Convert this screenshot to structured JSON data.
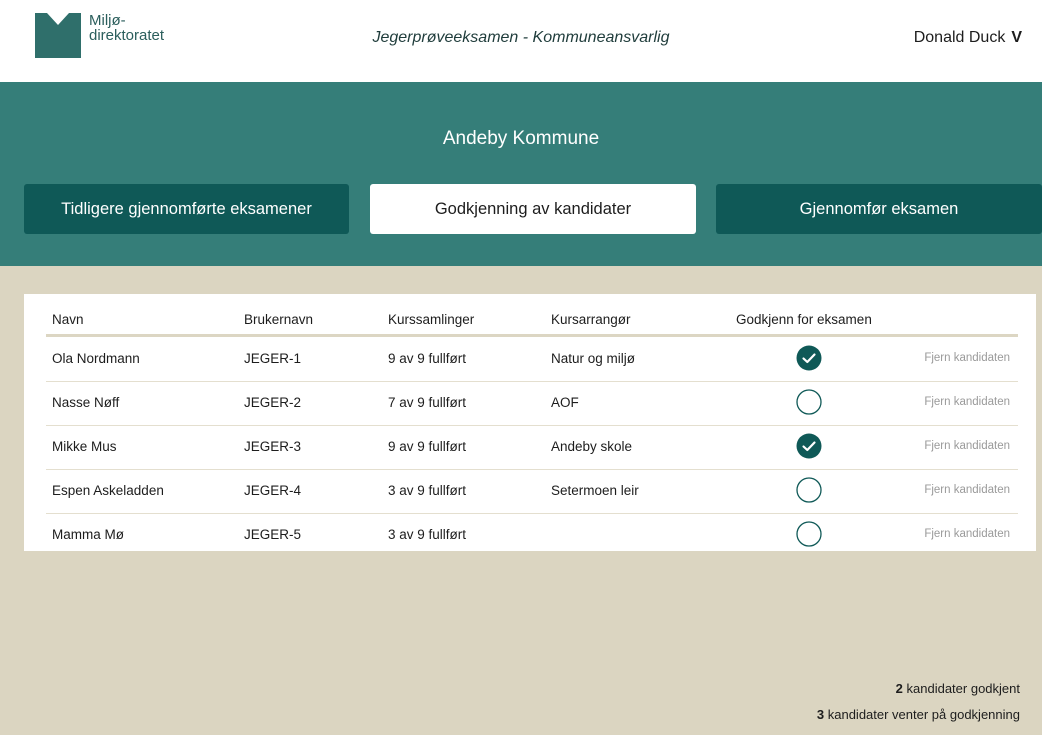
{
  "header": {
    "logo_line1": "Miljø-",
    "logo_line2": "direktoratet",
    "title": "Jegerprøveeksamen - Kommuneansvarlig",
    "user_name": "Donald Duck",
    "user_chevron": "V"
  },
  "municipality": "Andeby Kommune",
  "tabs": [
    {
      "label": "Tidligere gjennomførte eksamener",
      "active": false
    },
    {
      "label": "Godkjenning av kandidater",
      "active": true
    },
    {
      "label": "Gjennomfør eksamen",
      "active": false
    }
  ],
  "table": {
    "columns": [
      "Navn",
      "Brukernavn",
      "Kurssamlinger",
      "Kursarrangør",
      "Godkjenn for eksamen"
    ],
    "remove_label": "Fjern kandidaten",
    "rows": [
      {
        "name": "Ola Nordmann",
        "username": "JEGER-1",
        "sessions": "9 av 9 fullført",
        "organizer": "Natur og miljø",
        "approved": true
      },
      {
        "name": "Nasse Nøff",
        "username": "JEGER-2",
        "sessions": "7 av 9 fullført",
        "organizer": "AOF",
        "approved": false
      },
      {
        "name": "Mikke Mus",
        "username": "JEGER-3",
        "sessions": "9 av 9 fullført",
        "organizer": "Andeby skole",
        "approved": true
      },
      {
        "name": "Espen Askeladden",
        "username": "JEGER-4",
        "sessions": "3 av 9 fullført",
        "organizer": "Setermoen leir",
        "approved": false
      },
      {
        "name": "Mamma Mø",
        "username": "JEGER-5",
        "sessions": "3 av 9 fullført",
        "organizer": "",
        "approved": false
      }
    ]
  },
  "summary": {
    "approved_count": "2",
    "approved_text": " kandidater godkjent",
    "pending_count": "3",
    "pending_text": " kandidater venter på godkjenning"
  },
  "colors": {
    "brand_teal": "#357e79",
    "dark_teal": "#0f5957",
    "background": "#dbd5c1"
  }
}
